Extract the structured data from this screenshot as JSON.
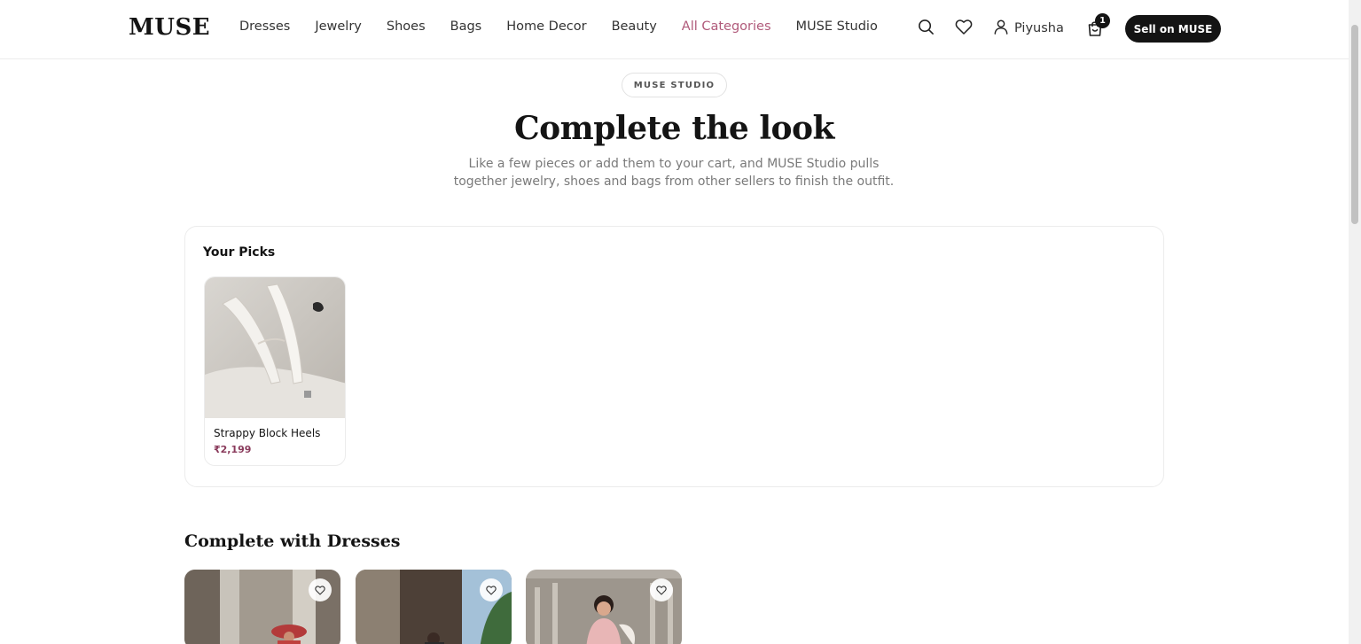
{
  "header": {
    "logo": "MUSE",
    "nav": [
      {
        "label": "Dresses",
        "active": false
      },
      {
        "label": "Jewelry",
        "active": false
      },
      {
        "label": "Shoes",
        "active": false
      },
      {
        "label": "Bags",
        "active": false
      },
      {
        "label": "Home Decor",
        "active": false
      },
      {
        "label": "Beauty",
        "active": false
      },
      {
        "label": "All Categories",
        "active": true
      },
      {
        "label": "MUSE Studio",
        "active": false
      }
    ],
    "user_name": "Piyusha",
    "cart_count": "1",
    "sell_button": "Sell on MUSE",
    "icons": [
      "search-icon",
      "heart-icon",
      "user-icon",
      "cart-icon"
    ]
  },
  "hero": {
    "pill": "MUSE STUDIO",
    "title": "Complete the look",
    "subtitle": "Like a few pieces or add them to your cart, and MUSE Studio pulls together jewelry, shoes and bags from other sellers to finish the outfit."
  },
  "picks": {
    "title": "Your Picks",
    "items": [
      {
        "name": "Strappy Block Heels",
        "price": "₹2,199"
      }
    ]
  },
  "section": {
    "title": "Complete with Dresses",
    "cards": 3
  },
  "colors": {
    "accent": "#b05a7a",
    "price": "#8a3b5c",
    "dark": "#141414"
  }
}
